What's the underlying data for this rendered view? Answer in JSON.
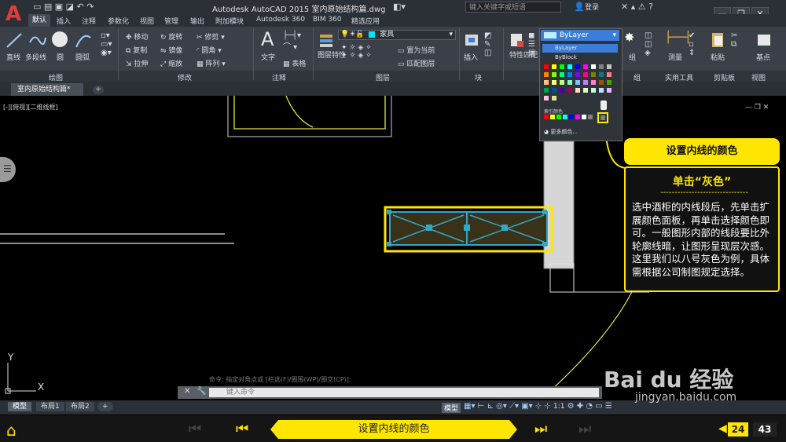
{
  "window": {
    "title": "Autodesk AutoCAD 2015    室内原始结构篇.dwg",
    "search_placeholder": "键入关键字或短语",
    "login": "登录"
  },
  "ribbon_tabs": [
    "默认",
    "插入",
    "注释",
    "参数化",
    "视图",
    "管理",
    "输出",
    "附加模块",
    "Autodesk 360",
    "BIM 360",
    "精选应用"
  ],
  "ribbon": {
    "draw": {
      "line": "直线",
      "polyline": "多段线",
      "circle": "圆",
      "arc": "圆弧"
    },
    "modify": {
      "move": "移动",
      "rotate": "旋转",
      "trim": "修剪",
      "copy": "复制",
      "mirror": "镜像",
      "fillet": "圆角",
      "stretch": "拉伸",
      "scale": "缩放",
      "array": "阵列"
    },
    "annotation": {
      "text": "文字",
      "table": "表格"
    },
    "layers": {
      "layer_props": "图层特性",
      "current_layer": "家具",
      "set_current": "置为当前",
      "match_layer": "匹配图层"
    },
    "block": {
      "insert": "插入"
    },
    "properties": {
      "match_properties": "特性匹配",
      "color_value": "ByLayer"
    },
    "right_tools": {
      "group": "组",
      "measure": "测量",
      "paste": "粘贴",
      "base": "基点"
    },
    "panel_labels": [
      "绘图",
      "修改",
      "注释",
      "图层",
      "块",
      "组",
      "实用工具",
      "剪贴板",
      "视图"
    ]
  },
  "color_dropdown": {
    "selected": "ByLayer",
    "options": [
      "ByLayer",
      "ByBlock"
    ],
    "more_colors": "更多颜色...",
    "section_label": "索引颜色",
    "palette": [
      "#ff0000",
      "#ffff00",
      "#00ff00",
      "#00ffff",
      "#0000ff",
      "#ff00ff",
      "#ffffff",
      "#808080",
      "#c0c0c0",
      "#ff7f00",
      "#7fff00",
      "#00ff7f",
      "#007fff",
      "#7f00ff",
      "#ff007f",
      "#7f7f00",
      "#007f7f",
      "#ff7f7f",
      "#ffbf7f",
      "#ffff7f",
      "#bfff7f",
      "#7fffbf",
      "#7fbfff",
      "#bf7fff",
      "#ff7fbf",
      "#a05000",
      "#50a000",
      "#00a050",
      "#0050a0",
      "#5000a0",
      "#a00050",
      "#ffdfbf",
      "#dfffbf",
      "#bfffdf",
      "#bfdfff",
      "#dfbfff",
      "#ffbfdf",
      "#e0e0a0"
    ],
    "standard_row": [
      "#ff0000",
      "#ffff00",
      "#00ff00",
      "#00ffff",
      "#0000ff",
      "#ff00ff",
      "#ffffff",
      "#808080"
    ]
  },
  "doc_tab": "室内原始结构篇*",
  "viewport_label": "[-][俯视][二维线框]",
  "callout": {
    "title": "设置内线的颜色",
    "subtitle": "单击“灰色”",
    "dashes": "-------------------------------",
    "text": "选中酒柜的内线段后，先单击扩展颜色面板，再单击选择颜色即可。一般图形内部的线段要比外轮廓线暗，让图形呈现层次感。这里我们以八号灰色为例，具体需根据公司制图规定选择。"
  },
  "command": {
    "history": "命令: 指定对角点或 [栏选(F)/圈围(WP)/圈交(CP)]:",
    "placeholder": "键入命令"
  },
  "layout_tabs": [
    "模型",
    "布局1",
    "布局2"
  ],
  "status": {
    "model": "模型",
    "scale": "1:1"
  },
  "axis": {
    "x": "X",
    "y": "Y"
  },
  "nav": {
    "title": "设置内线的颜色",
    "current_page": "24",
    "total_pages": "43"
  },
  "watermark": {
    "brand": "Bai du 经验",
    "site": "jingyan.baidu.com"
  },
  "colors": {
    "accent_yellow": "#ffe600",
    "drawing_cyan": "#2fa8c8",
    "drawing_yellow": "#e8e24a",
    "ribbon_bg": "#3a3f48"
  }
}
